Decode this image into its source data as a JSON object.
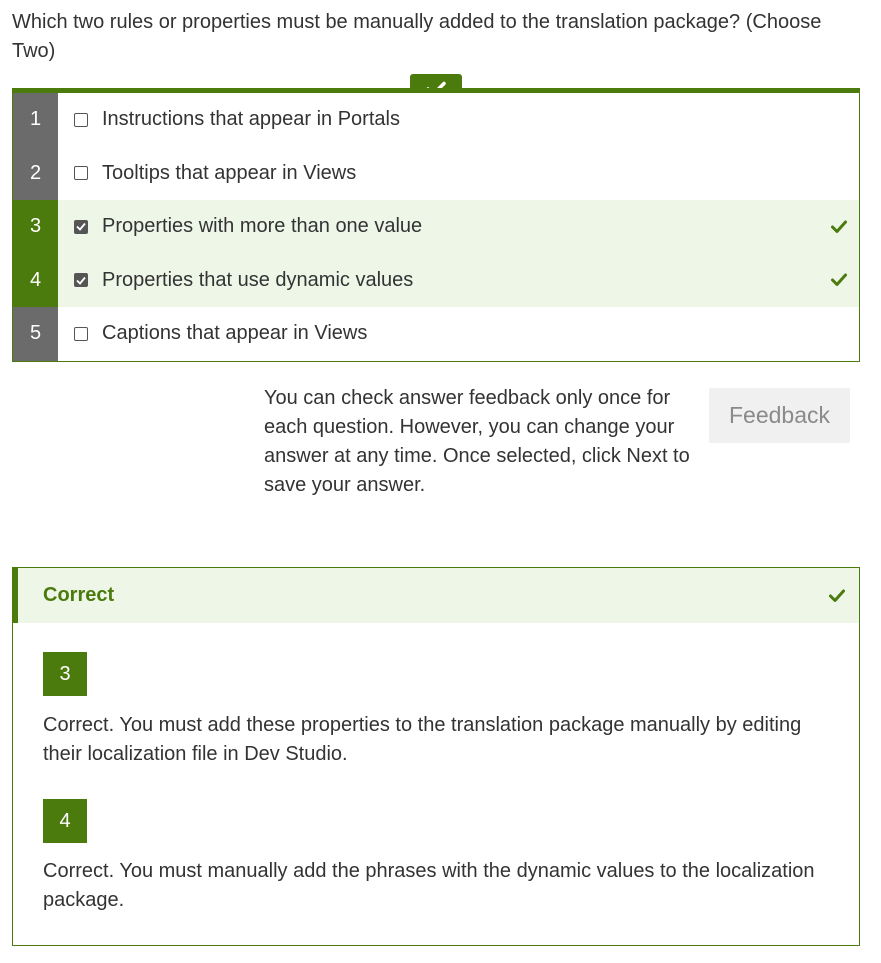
{
  "question": {
    "text": "Which two rules or properties must be manually added to the translation package? (Choose Two)"
  },
  "options": [
    {
      "number": "1",
      "label": "Instructions that appear in Portals",
      "checked": false,
      "correct": false
    },
    {
      "number": "2",
      "label": "Tooltips that appear in Views",
      "checked": false,
      "correct": false
    },
    {
      "number": "3",
      "label": "Properties with more than one value",
      "checked": true,
      "correct": true
    },
    {
      "number": "4",
      "label": "Properties that use dynamic values",
      "checked": true,
      "correct": true
    },
    {
      "number": "5",
      "label": "Captions that appear in Views",
      "checked": false,
      "correct": false
    }
  ],
  "info": {
    "text": "You can check answer feedback only once for each question. However, you can change your answer at any time. Once selected, click Next to save your answer."
  },
  "buttons": {
    "feedback_label": "Feedback"
  },
  "feedback": {
    "title": "Correct",
    "items": [
      {
        "number": "3",
        "text": "Correct. You must add these properties to the translation package manually by editing their localization file in Dev Studio."
      },
      {
        "number": "4",
        "text": "Correct. You must manually add the phrases with the dynamic values to the localization package."
      }
    ]
  },
  "colors": {
    "accent": "#4b7a0d",
    "correct_bg": "#eef6e8",
    "number_bg": "#6b6b6b"
  },
  "icons": {
    "result": "check-icon",
    "checkbox": "checkbox-icon"
  }
}
